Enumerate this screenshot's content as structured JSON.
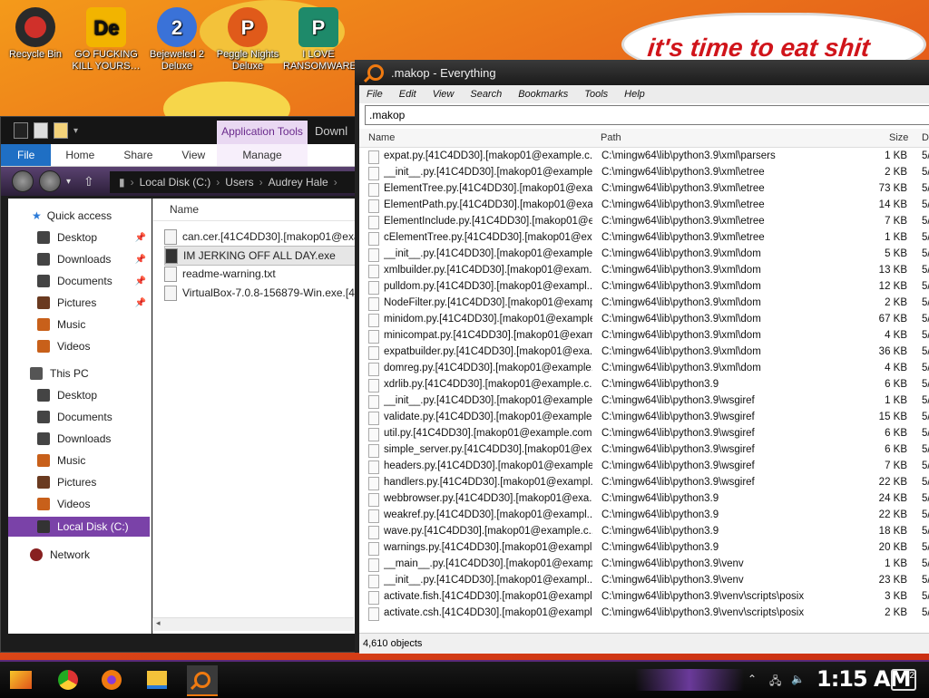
{
  "wallpaper": {
    "caption": "it's time to eat shit"
  },
  "desktop_icons": [
    {
      "label": "Recycle Bin",
      "color": "#d0302a"
    },
    {
      "label": "GO FUCKING KILL YOURS…",
      "color": "#f2b400"
    },
    {
      "label": "Bejeweled 2 Deluxe",
      "color": "#3a72d8"
    },
    {
      "label": "Peggle Nights Deluxe",
      "color": "#e05a1a"
    },
    {
      "label": "I LOVE RANSOMWARE",
      "color": "#1e8a6a"
    }
  ],
  "explorer": {
    "ribbon_group": "Application Tools",
    "truncated_title": "Downl",
    "tabs": [
      "File",
      "Home",
      "Share",
      "View",
      "Manage"
    ],
    "breadcrumb": [
      "Local Disk (C:)",
      "Users",
      "Audrey Hale"
    ],
    "nav": {
      "quick_access": "Quick access",
      "quick_items": [
        "Desktop",
        "Downloads",
        "Documents",
        "Pictures",
        "Music",
        "Videos"
      ],
      "this_pc": "This PC",
      "pc_items": [
        "Desktop",
        "Documents",
        "Downloads",
        "Music",
        "Pictures",
        "Videos"
      ],
      "local_disk": "Local Disk (C:)",
      "network": "Network"
    },
    "column_name": "Name",
    "files": [
      "can.cer.[41C4DD30].[makop01@exam",
      "IM JERKING OFF ALL DAY.exe",
      "readme-warning.txt",
      "VirtualBox-7.0.8-156879-Win.exe.[41C"
    ]
  },
  "everything": {
    "title": ".makop - Everything",
    "menu": [
      "File",
      "Edit",
      "View",
      "Search",
      "Bookmarks",
      "Tools",
      "Help"
    ],
    "search_value": ".makop",
    "columns": {
      "name": "Name",
      "path": "Path",
      "size": "Size",
      "date": "Da"
    },
    "rows": [
      {
        "name": "expat.py.[41C4DD30].[makop01@example.c...",
        "path": "C:\\mingw64\\lib\\python3.9\\xml\\parsers",
        "size": "1 KB",
        "date": "5/1"
      },
      {
        "name": "__init__.py.[41C4DD30].[makop01@example...",
        "path": "C:\\mingw64\\lib\\python3.9\\xml\\etree",
        "size": "2 KB",
        "date": "5/1"
      },
      {
        "name": "ElementTree.py.[41C4DD30].[makop01@exa...",
        "path": "C:\\mingw64\\lib\\python3.9\\xml\\etree",
        "size": "73 KB",
        "date": "5/1"
      },
      {
        "name": "ElementPath.py.[41C4DD30].[makop01@exa...",
        "path": "C:\\mingw64\\lib\\python3.9\\xml\\etree",
        "size": "14 KB",
        "date": "5/1"
      },
      {
        "name": "ElementInclude.py.[41C4DD30].[makop01@e...",
        "path": "C:\\mingw64\\lib\\python3.9\\xml\\etree",
        "size": "7 KB",
        "date": "5/1"
      },
      {
        "name": "cElementTree.py.[41C4DD30].[makop01@ex...",
        "path": "C:\\mingw64\\lib\\python3.9\\xml\\etree",
        "size": "1 KB",
        "date": "5/1"
      },
      {
        "name": "__init__.py.[41C4DD30].[makop01@example...",
        "path": "C:\\mingw64\\lib\\python3.9\\xml\\dom",
        "size": "5 KB",
        "date": "5/1"
      },
      {
        "name": "xmlbuilder.py.[41C4DD30].[makop01@exam...",
        "path": "C:\\mingw64\\lib\\python3.9\\xml\\dom",
        "size": "13 KB",
        "date": "5/1"
      },
      {
        "name": "pulldom.py.[41C4DD30].[makop01@exampl...",
        "path": "C:\\mingw64\\lib\\python3.9\\xml\\dom",
        "size": "12 KB",
        "date": "5/1"
      },
      {
        "name": "NodeFilter.py.[41C4DD30].[makop01@examp...",
        "path": "C:\\mingw64\\lib\\python3.9\\xml\\dom",
        "size": "2 KB",
        "date": "5/1"
      },
      {
        "name": "minidom.py.[41C4DD30].[makop01@example...",
        "path": "C:\\mingw64\\lib\\python3.9\\xml\\dom",
        "size": "67 KB",
        "date": "5/1"
      },
      {
        "name": "minicompat.py.[41C4DD30].[makop01@exam...",
        "path": "C:\\mingw64\\lib\\python3.9\\xml\\dom",
        "size": "4 KB",
        "date": "5/1"
      },
      {
        "name": "expatbuilder.py.[41C4DD30].[makop01@exa...",
        "path": "C:\\mingw64\\lib\\python3.9\\xml\\dom",
        "size": "36 KB",
        "date": "5/1"
      },
      {
        "name": "domreg.py.[41C4DD30].[makop01@example...",
        "path": "C:\\mingw64\\lib\\python3.9\\xml\\dom",
        "size": "4 KB",
        "date": "5/1"
      },
      {
        "name": "xdrlib.py.[41C4DD30].[makop01@example.c...",
        "path": "C:\\mingw64\\lib\\python3.9",
        "size": "6 KB",
        "date": "5/1"
      },
      {
        "name": "__init__.py.[41C4DD30].[makop01@example...",
        "path": "C:\\mingw64\\lib\\python3.9\\wsgiref",
        "size": "1 KB",
        "date": "5/1"
      },
      {
        "name": "validate.py.[41C4DD30].[makop01@example...",
        "path": "C:\\mingw64\\lib\\python3.9\\wsgiref",
        "size": "15 KB",
        "date": "5/1"
      },
      {
        "name": "util.py.[41C4DD30].[makop01@example.com...",
        "path": "C:\\mingw64\\lib\\python3.9\\wsgiref",
        "size": "6 KB",
        "date": "5/1"
      },
      {
        "name": "simple_server.py.[41C4DD30].[makop01@ex...",
        "path": "C:\\mingw64\\lib\\python3.9\\wsgiref",
        "size": "6 KB",
        "date": "5/1"
      },
      {
        "name": "headers.py.[41C4DD30].[makop01@example...",
        "path": "C:\\mingw64\\lib\\python3.9\\wsgiref",
        "size": "7 KB",
        "date": "5/1"
      },
      {
        "name": "handlers.py.[41C4DD30].[makop01@exampl...",
        "path": "C:\\mingw64\\lib\\python3.9\\wsgiref",
        "size": "22 KB",
        "date": "5/1"
      },
      {
        "name": "webbrowser.py.[41C4DD30].[makop01@exa...",
        "path": "C:\\mingw64\\lib\\python3.9",
        "size": "24 KB",
        "date": "5/1"
      },
      {
        "name": "weakref.py.[41C4DD30].[makop01@exampl...",
        "path": "C:\\mingw64\\lib\\python3.9",
        "size": "22 KB",
        "date": "5/1"
      },
      {
        "name": "wave.py.[41C4DD30].[makop01@example.c...",
        "path": "C:\\mingw64\\lib\\python3.9",
        "size": "18 KB",
        "date": "5/1"
      },
      {
        "name": "warnings.py.[41C4DD30].[makop01@exampl...",
        "path": "C:\\mingw64\\lib\\python3.9",
        "size": "20 KB",
        "date": "5/1"
      },
      {
        "name": "__main__.py.[41C4DD30].[makop01@exampl...",
        "path": "C:\\mingw64\\lib\\python3.9\\venv",
        "size": "1 KB",
        "date": "5/1"
      },
      {
        "name": "__init__.py.[41C4DD30].[makop01@exampl...",
        "path": "C:\\mingw64\\lib\\python3.9\\venv",
        "size": "23 KB",
        "date": "5/1"
      },
      {
        "name": "activate.fish.[41C4DD30].[makop01@exampl...",
        "path": "C:\\mingw64\\lib\\python3.9\\venv\\scripts\\posix",
        "size": "3 KB",
        "date": "5/1"
      },
      {
        "name": "activate.csh.[41C4DD30].[makop01@exampl...",
        "path": "C:\\mingw64\\lib\\python3.9\\venv\\scripts\\posix",
        "size": "2 KB",
        "date": "5/1"
      }
    ],
    "status": "4,610 objects"
  },
  "taskbar": {
    "clock": "1:15 AM",
    "notification_count": "2",
    "pinned": [
      "start-icon",
      "chrome-icon",
      "firefox-icon",
      "file-explorer-icon",
      "everything-icon"
    ]
  }
}
